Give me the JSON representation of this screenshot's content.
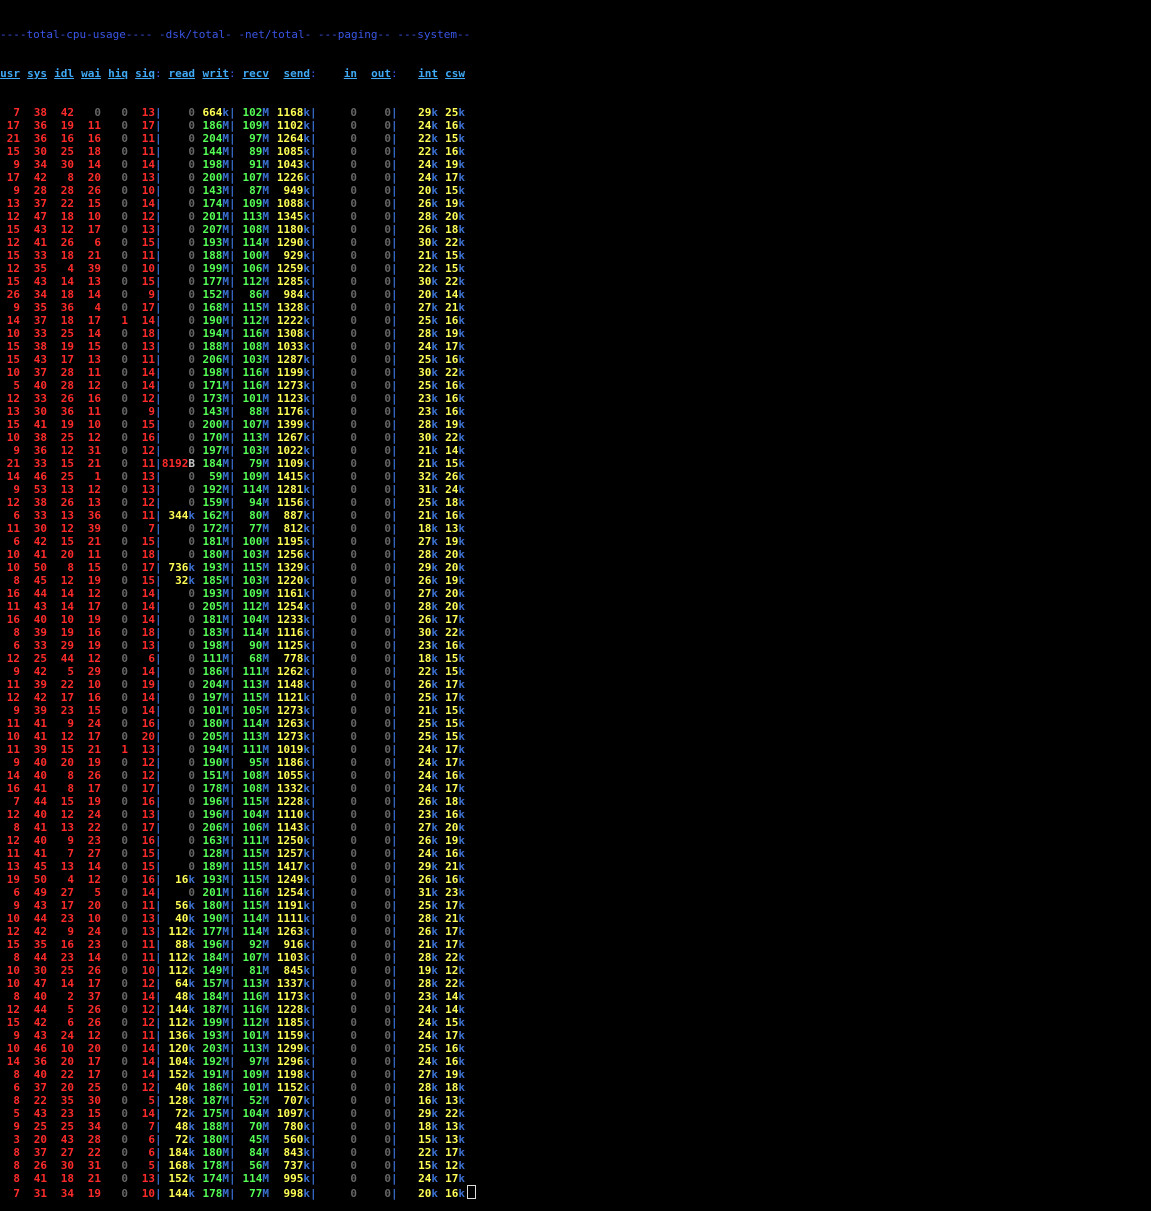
{
  "groups": [
    "----total-cpu-usage----",
    "-dsk/total-",
    "-net/total-",
    "---paging--",
    "---system--"
  ],
  "columns": [
    "usr",
    "sys",
    "idl",
    "wai",
    "hiq",
    "siq",
    "read",
    "writ",
    "recv",
    "send",
    "in",
    "out",
    "int",
    "csw"
  ],
  "rows": [
    [
      "7",
      "38",
      "42",
      "0",
      "0",
      "13",
      "0",
      "664k",
      "102M",
      "1168k",
      "0",
      "0",
      "29k",
      "25k"
    ],
    [
      "17",
      "36",
      "19",
      "11",
      "0",
      "17",
      "0",
      "186M",
      "109M",
      "1102k",
      "0",
      "0",
      "24k",
      "16k"
    ],
    [
      "21",
      "36",
      "16",
      "16",
      "0",
      "11",
      "0",
      "204M",
      "97M",
      "1264k",
      "0",
      "0",
      "22k",
      "15k"
    ],
    [
      "15",
      "30",
      "25",
      "18",
      "0",
      "11",
      "0",
      "144M",
      "89M",
      "1085k",
      "0",
      "0",
      "22k",
      "16k"
    ],
    [
      "9",
      "34",
      "30",
      "14",
      "0",
      "14",
      "0",
      "198M",
      "91M",
      "1043k",
      "0",
      "0",
      "24k",
      "19k"
    ],
    [
      "17",
      "42",
      "8",
      "20",
      "0",
      "13",
      "0",
      "200M",
      "107M",
      "1226k",
      "0",
      "0",
      "24k",
      "17k"
    ],
    [
      "9",
      "28",
      "28",
      "26",
      "0",
      "10",
      "0",
      "143M",
      "87M",
      "949k",
      "0",
      "0",
      "20k",
      "15k"
    ],
    [
      "13",
      "37",
      "22",
      "15",
      "0",
      "14",
      "0",
      "174M",
      "109M",
      "1088k",
      "0",
      "0",
      "26k",
      "19k"
    ],
    [
      "12",
      "47",
      "18",
      "10",
      "0",
      "12",
      "0",
      "201M",
      "113M",
      "1345k",
      "0",
      "0",
      "28k",
      "20k"
    ],
    [
      "15",
      "43",
      "12",
      "17",
      "0",
      "13",
      "0",
      "207M",
      "108M",
      "1180k",
      "0",
      "0",
      "26k",
      "18k"
    ],
    [
      "12",
      "41",
      "26",
      "6",
      "0",
      "15",
      "0",
      "193M",
      "114M",
      "1290k",
      "0",
      "0",
      "30k",
      "22k"
    ],
    [
      "15",
      "33",
      "18",
      "21",
      "0",
      "11",
      "0",
      "188M",
      "100M",
      "929k",
      "0",
      "0",
      "21k",
      "15k"
    ],
    [
      "12",
      "35",
      "4",
      "39",
      "0",
      "10",
      "0",
      "199M",
      "106M",
      "1259k",
      "0",
      "0",
      "22k",
      "15k"
    ],
    [
      "15",
      "43",
      "14",
      "13",
      "0",
      "15",
      "0",
      "177M",
      "112M",
      "1285k",
      "0",
      "0",
      "30k",
      "22k"
    ],
    [
      "26",
      "34",
      "18",
      "14",
      "0",
      "9",
      "0",
      "152M",
      "86M",
      "984k",
      "0",
      "0",
      "20k",
      "14k"
    ],
    [
      "9",
      "35",
      "36",
      "4",
      "0",
      "17",
      "0",
      "168M",
      "115M",
      "1328k",
      "0",
      "0",
      "27k",
      "21k"
    ],
    [
      "14",
      "37",
      "18",
      "17",
      "1",
      "14",
      "0",
      "190M",
      "112M",
      "1222k",
      "0",
      "0",
      "25k",
      "16k"
    ],
    [
      "10",
      "33",
      "25",
      "14",
      "0",
      "18",
      "0",
      "194M",
      "116M",
      "1308k",
      "0",
      "0",
      "28k",
      "19k"
    ],
    [
      "15",
      "38",
      "19",
      "15",
      "0",
      "13",
      "0",
      "188M",
      "108M",
      "1033k",
      "0",
      "0",
      "24k",
      "17k"
    ],
    [
      "15",
      "43",
      "17",
      "13",
      "0",
      "11",
      "0",
      "206M",
      "103M",
      "1287k",
      "0",
      "0",
      "25k",
      "16k"
    ],
    [
      "10",
      "37",
      "28",
      "11",
      "0",
      "14",
      "0",
      "198M",
      "116M",
      "1199k",
      "0",
      "0",
      "30k",
      "22k"
    ],
    [
      "5",
      "40",
      "28",
      "12",
      "0",
      "14",
      "0",
      "171M",
      "116M",
      "1273k",
      "0",
      "0",
      "25k",
      "16k"
    ],
    [
      "12",
      "33",
      "26",
      "16",
      "0",
      "12",
      "0",
      "173M",
      "101M",
      "1123k",
      "0",
      "0",
      "23k",
      "16k"
    ],
    [
      "13",
      "30",
      "36",
      "11",
      "0",
      "9",
      "0",
      "143M",
      "88M",
      "1176k",
      "0",
      "0",
      "23k",
      "16k"
    ],
    [
      "15",
      "41",
      "19",
      "10",
      "0",
      "15",
      "0",
      "200M",
      "107M",
      "1399k",
      "0",
      "0",
      "28k",
      "19k"
    ],
    [
      "10",
      "38",
      "25",
      "12",
      "0",
      "16",
      "0",
      "170M",
      "113M",
      "1267k",
      "0",
      "0",
      "30k",
      "22k"
    ],
    [
      "9",
      "36",
      "12",
      "31",
      "0",
      "12",
      "0",
      "197M",
      "103M",
      "1022k",
      "0",
      "0",
      "21k",
      "14k"
    ],
    [
      "21",
      "33",
      "15",
      "21",
      "0",
      "11",
      "8192B",
      "184M",
      "79M",
      "1109k",
      "0",
      "0",
      "21k",
      "15k"
    ],
    [
      "14",
      "46",
      "25",
      "1",
      "0",
      "13",
      "0",
      "59M",
      "109M",
      "1415k",
      "0",
      "0",
      "32k",
      "26k"
    ],
    [
      "9",
      "53",
      "13",
      "12",
      "0",
      "13",
      "0",
      "192M",
      "114M",
      "1281k",
      "0",
      "0",
      "31k",
      "24k"
    ],
    [
      "12",
      "38",
      "26",
      "13",
      "0",
      "12",
      "0",
      "159M",
      "94M",
      "1156k",
      "0",
      "0",
      "25k",
      "18k"
    ],
    [
      "6",
      "33",
      "13",
      "36",
      "0",
      "11",
      "344k",
      "162M",
      "80M",
      "887k",
      "0",
      "0",
      "21k",
      "16k"
    ],
    [
      "11",
      "30",
      "12",
      "39",
      "0",
      "7",
      "0",
      "172M",
      "77M",
      "812k",
      "0",
      "0",
      "18k",
      "13k"
    ],
    [
      "6",
      "42",
      "15",
      "21",
      "0",
      "15",
      "0",
      "181M",
      "100M",
      "1195k",
      "0",
      "0",
      "27k",
      "19k"
    ],
    [
      "10",
      "41",
      "20",
      "11",
      "0",
      "18",
      "0",
      "180M",
      "103M",
      "1256k",
      "0",
      "0",
      "28k",
      "20k"
    ],
    [
      "10",
      "50",
      "8",
      "15",
      "0",
      "17",
      "736k",
      "193M",
      "115M",
      "1329k",
      "0",
      "0",
      "29k",
      "20k"
    ],
    [
      "8",
      "45",
      "12",
      "19",
      "0",
      "15",
      "32k",
      "185M",
      "103M",
      "1220k",
      "0",
      "0",
      "26k",
      "19k"
    ],
    [
      "16",
      "44",
      "14",
      "12",
      "0",
      "14",
      "0",
      "193M",
      "109M",
      "1161k",
      "0",
      "0",
      "27k",
      "20k"
    ],
    [
      "11",
      "43",
      "14",
      "17",
      "0",
      "14",
      "0",
      "205M",
      "112M",
      "1254k",
      "0",
      "0",
      "28k",
      "20k"
    ],
    [
      "16",
      "40",
      "10",
      "19",
      "0",
      "14",
      "0",
      "181M",
      "104M",
      "1233k",
      "0",
      "0",
      "26k",
      "17k"
    ],
    [
      "8",
      "39",
      "19",
      "16",
      "0",
      "18",
      "0",
      "183M",
      "114M",
      "1116k",
      "0",
      "0",
      "30k",
      "22k"
    ],
    [
      "6",
      "33",
      "29",
      "19",
      "0",
      "13",
      "0",
      "198M",
      "90M",
      "1125k",
      "0",
      "0",
      "23k",
      "16k"
    ],
    [
      "12",
      "25",
      "44",
      "12",
      "0",
      "6",
      "0",
      "111M",
      "68M",
      "778k",
      "0",
      "0",
      "18k",
      "15k"
    ],
    [
      "9",
      "42",
      "5",
      "29",
      "0",
      "14",
      "0",
      "186M",
      "111M",
      "1262k",
      "0",
      "0",
      "22k",
      "15k"
    ],
    [
      "11",
      "39",
      "22",
      "10",
      "0",
      "19",
      "0",
      "204M",
      "113M",
      "1148k",
      "0",
      "0",
      "26k",
      "17k"
    ],
    [
      "12",
      "42",
      "17",
      "16",
      "0",
      "14",
      "0",
      "197M",
      "115M",
      "1121k",
      "0",
      "0",
      "25k",
      "17k"
    ],
    [
      "9",
      "39",
      "23",
      "15",
      "0",
      "14",
      "0",
      "101M",
      "105M",
      "1273k",
      "0",
      "0",
      "21k",
      "15k"
    ],
    [
      "11",
      "41",
      "9",
      "24",
      "0",
      "16",
      "0",
      "180M",
      "114M",
      "1263k",
      "0",
      "0",
      "25k",
      "15k"
    ],
    [
      "10",
      "41",
      "12",
      "17",
      "0",
      "20",
      "0",
      "205M",
      "113M",
      "1273k",
      "0",
      "0",
      "25k",
      "15k"
    ],
    [
      "11",
      "39",
      "15",
      "21",
      "1",
      "13",
      "0",
      "194M",
      "111M",
      "1019k",
      "0",
      "0",
      "24k",
      "17k"
    ],
    [
      "9",
      "40",
      "20",
      "19",
      "0",
      "12",
      "0",
      "190M",
      "95M",
      "1186k",
      "0",
      "0",
      "24k",
      "17k"
    ],
    [
      "14",
      "40",
      "8",
      "26",
      "0",
      "12",
      "0",
      "151M",
      "108M",
      "1055k",
      "0",
      "0",
      "24k",
      "16k"
    ],
    [
      "16",
      "41",
      "8",
      "17",
      "0",
      "17",
      "0",
      "178M",
      "108M",
      "1332k",
      "0",
      "0",
      "24k",
      "17k"
    ],
    [
      "7",
      "44",
      "15",
      "19",
      "0",
      "16",
      "0",
      "196M",
      "115M",
      "1228k",
      "0",
      "0",
      "26k",
      "18k"
    ],
    [
      "12",
      "40",
      "12",
      "24",
      "0",
      "13",
      "0",
      "196M",
      "104M",
      "1110k",
      "0",
      "0",
      "23k",
      "16k"
    ],
    [
      "8",
      "41",
      "13",
      "22",
      "0",
      "17",
      "0",
      "206M",
      "106M",
      "1143k",
      "0",
      "0",
      "27k",
      "20k"
    ],
    [
      "12",
      "40",
      "9",
      "23",
      "0",
      "16",
      "0",
      "163M",
      "111M",
      "1250k",
      "0",
      "0",
      "26k",
      "19k"
    ],
    [
      "11",
      "41",
      "7",
      "27",
      "0",
      "15",
      "0",
      "128M",
      "115M",
      "1257k",
      "0",
      "0",
      "24k",
      "16k"
    ],
    [
      "13",
      "45",
      "13",
      "14",
      "0",
      "15",
      "0",
      "189M",
      "115M",
      "1417k",
      "0",
      "0",
      "29k",
      "21k"
    ],
    [
      "19",
      "50",
      "4",
      "12",
      "0",
      "16",
      "16k",
      "193M",
      "115M",
      "1249k",
      "0",
      "0",
      "26k",
      "16k"
    ],
    [
      "6",
      "49",
      "27",
      "5",
      "0",
      "14",
      "0",
      "201M",
      "116M",
      "1254k",
      "0",
      "0",
      "31k",
      "23k"
    ],
    [
      "9",
      "43",
      "17",
      "20",
      "0",
      "11",
      "56k",
      "180M",
      "115M",
      "1191k",
      "0",
      "0",
      "25k",
      "17k"
    ],
    [
      "10",
      "44",
      "23",
      "10",
      "0",
      "13",
      "40k",
      "190M",
      "114M",
      "1111k",
      "0",
      "0",
      "28k",
      "21k"
    ],
    [
      "12",
      "42",
      "9",
      "24",
      "0",
      "13",
      "112k",
      "177M",
      "114M",
      "1263k",
      "0",
      "0",
      "26k",
      "17k"
    ],
    [
      "15",
      "35",
      "16",
      "23",
      "0",
      "11",
      "88k",
      "196M",
      "92M",
      "916k",
      "0",
      "0",
      "21k",
      "17k"
    ],
    [
      "8",
      "44",
      "23",
      "14",
      "0",
      "11",
      "112k",
      "184M",
      "107M",
      "1103k",
      "0",
      "0",
      "28k",
      "22k"
    ],
    [
      "10",
      "30",
      "25",
      "26",
      "0",
      "10",
      "112k",
      "149M",
      "81M",
      "845k",
      "0",
      "0",
      "19k",
      "12k"
    ],
    [
      "10",
      "47",
      "14",
      "17",
      "0",
      "12",
      "64k",
      "157M",
      "113M",
      "1337k",
      "0",
      "0",
      "28k",
      "22k"
    ],
    [
      "8",
      "40",
      "2",
      "37",
      "0",
      "14",
      "48k",
      "184M",
      "116M",
      "1173k",
      "0",
      "0",
      "23k",
      "14k"
    ],
    [
      "12",
      "44",
      "5",
      "26",
      "0",
      "12",
      "144k",
      "187M",
      "116M",
      "1228k",
      "0",
      "0",
      "24k",
      "14k"
    ],
    [
      "15",
      "42",
      "6",
      "26",
      "0",
      "12",
      "112k",
      "199M",
      "112M",
      "1185k",
      "0",
      "0",
      "24k",
      "15k"
    ],
    [
      "9",
      "43",
      "24",
      "12",
      "0",
      "11",
      "136k",
      "193M",
      "101M",
      "1159k",
      "0",
      "0",
      "24k",
      "17k"
    ],
    [
      "10",
      "46",
      "10",
      "20",
      "0",
      "14",
      "120k",
      "203M",
      "113M",
      "1299k",
      "0",
      "0",
      "25k",
      "16k"
    ],
    [
      "14",
      "36",
      "20",
      "17",
      "0",
      "14",
      "104k",
      "192M",
      "97M",
      "1296k",
      "0",
      "0",
      "24k",
      "16k"
    ],
    [
      "8",
      "40",
      "22",
      "17",
      "0",
      "14",
      "152k",
      "191M",
      "109M",
      "1198k",
      "0",
      "0",
      "27k",
      "19k"
    ],
    [
      "6",
      "37",
      "20",
      "25",
      "0",
      "12",
      "40k",
      "186M",
      "101M",
      "1152k",
      "0",
      "0",
      "28k",
      "18k"
    ],
    [
      "8",
      "22",
      "35",
      "30",
      "0",
      "5",
      "128k",
      "187M",
      "52M",
      "707k",
      "0",
      "0",
      "16k",
      "13k"
    ],
    [
      "5",
      "43",
      "23",
      "15",
      "0",
      "14",
      "72k",
      "175M",
      "104M",
      "1097k",
      "0",
      "0",
      "29k",
      "22k"
    ],
    [
      "9",
      "25",
      "25",
      "34",
      "0",
      "7",
      "48k",
      "188M",
      "70M",
      "780k",
      "0",
      "0",
      "18k",
      "13k"
    ],
    [
      "3",
      "20",
      "43",
      "28",
      "0",
      "6",
      "72k",
      "180M",
      "45M",
      "560k",
      "0",
      "0",
      "15k",
      "13k"
    ],
    [
      "8",
      "37",
      "27",
      "22",
      "0",
      "6",
      "184k",
      "180M",
      "84M",
      "843k",
      "0",
      "0",
      "22k",
      "17k"
    ],
    [
      "8",
      "26",
      "30",
      "31",
      "0",
      "5",
      "168k",
      "178M",
      "56M",
      "737k",
      "0",
      "0",
      "15k",
      "12k"
    ],
    [
      "8",
      "41",
      "18",
      "21",
      "0",
      "13",
      "152k",
      "174M",
      "114M",
      "995k",
      "0",
      "0",
      "24k",
      "17k"
    ],
    [
      "7",
      "31",
      "34",
      "19",
      "0",
      "10",
      "144k",
      "178M",
      "77M",
      "998k",
      "0",
      "0",
      "20k",
      "16k"
    ]
  ],
  "colors": {
    "cpu": "#ff2b2b",
    "disk": "#ffff55",
    "net": "#55ff55",
    "zero": "#666666",
    "header": "#3fa9f5",
    "group": "#3a55e6"
  }
}
